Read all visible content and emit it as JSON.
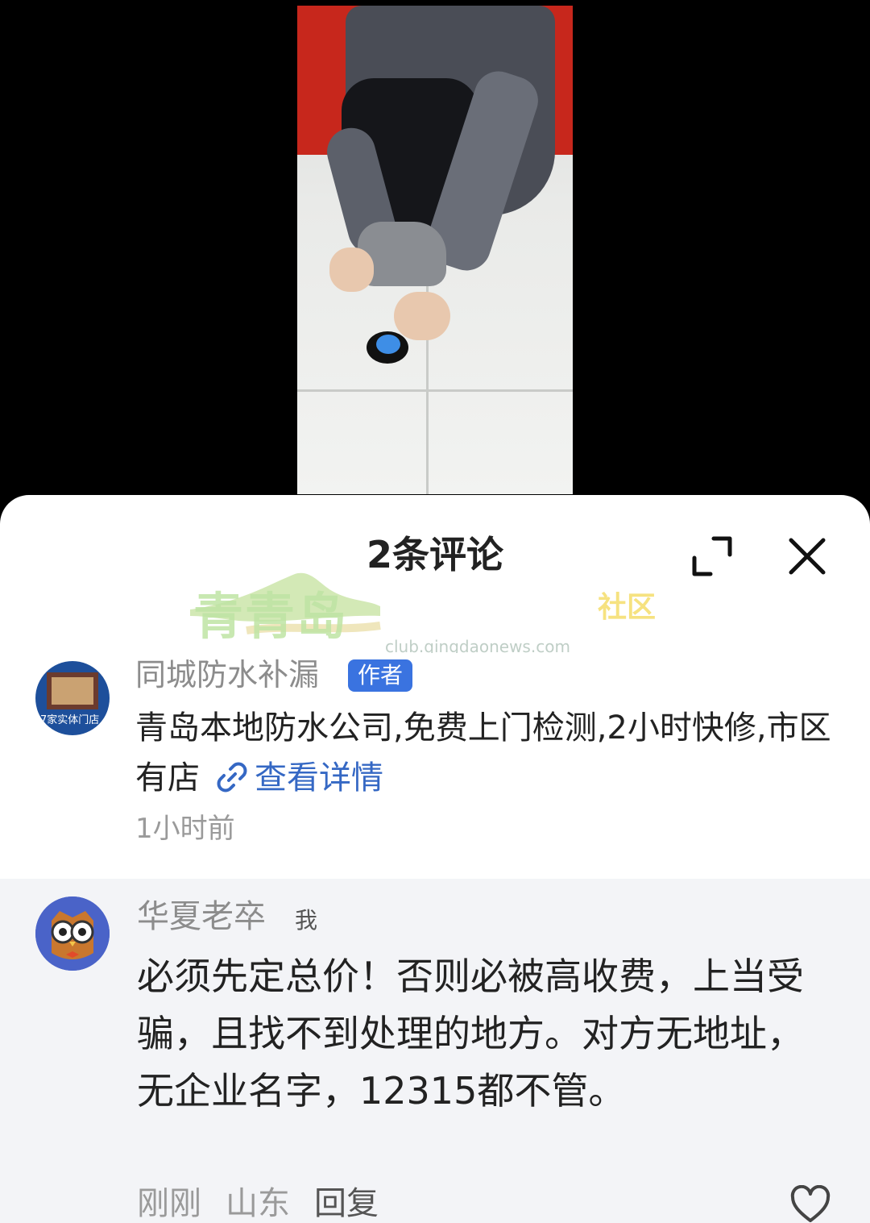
{
  "sheet": {
    "title": "2条评论",
    "expand_icon": "expand-icon",
    "close_icon": "close-icon"
  },
  "watermark": {
    "brand_cn": "青青岛",
    "brand_suffix": "社区",
    "url": "club.qingdaonews.com"
  },
  "comments": [
    {
      "author": "同城防水补漏",
      "badge": "作者",
      "avatar_text": "7家实体门店",
      "text": "青岛本地防水公司,免费上门检测,2小时快修,市区有店",
      "link_label": "查看详情",
      "time": "1小时前"
    },
    {
      "author": "华夏老卒",
      "tag": "我",
      "text": "必须先定总价！否则必被高收费，上当受骗，且找不到处理的地方。对方无地址，无企业名字，12315都不管。",
      "time": "刚刚",
      "location": "山东",
      "reply_label": "回复"
    }
  ],
  "colors": {
    "badge_bg": "#3a73e0",
    "link": "#3568c4",
    "comment2_bg": "#f3f4f7"
  }
}
